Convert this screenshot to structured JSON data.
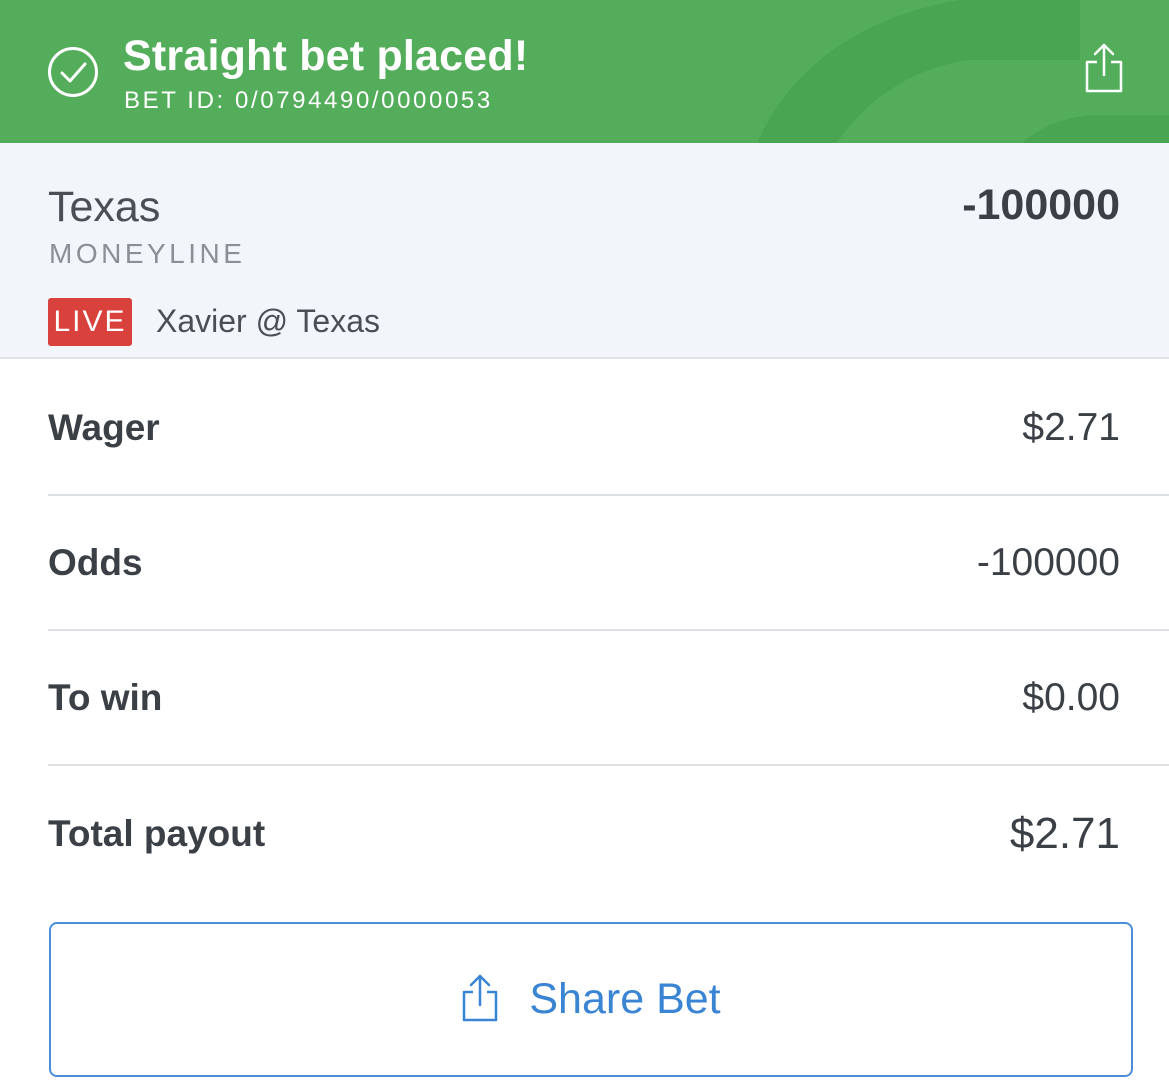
{
  "colors": {
    "header_bg": "#53ad5b",
    "live_badge": "#d9413d",
    "share_accent": "#3a84d4",
    "selection_bg": "#f2f5f9"
  },
  "header": {
    "title": "Straight bet placed!",
    "bet_id": "BET ID: 0/0794490/0000053",
    "status_icon": "check-circle-icon",
    "share_icon": "share-icon"
  },
  "selection": {
    "team": "Texas",
    "bet_type": "MONEYLINE",
    "odds": "-100000",
    "live_badge": "LIVE",
    "matchup": "Xavier @ Texas"
  },
  "details": [
    {
      "label": "Wager",
      "value": "$2.71"
    },
    {
      "label": "Odds",
      "value": "-100000"
    },
    {
      "label": "To win",
      "value": "$0.00"
    },
    {
      "label": "Total payout",
      "value": "$2.71"
    }
  ],
  "share_button": {
    "label": "Share Bet",
    "icon": "share-icon"
  }
}
